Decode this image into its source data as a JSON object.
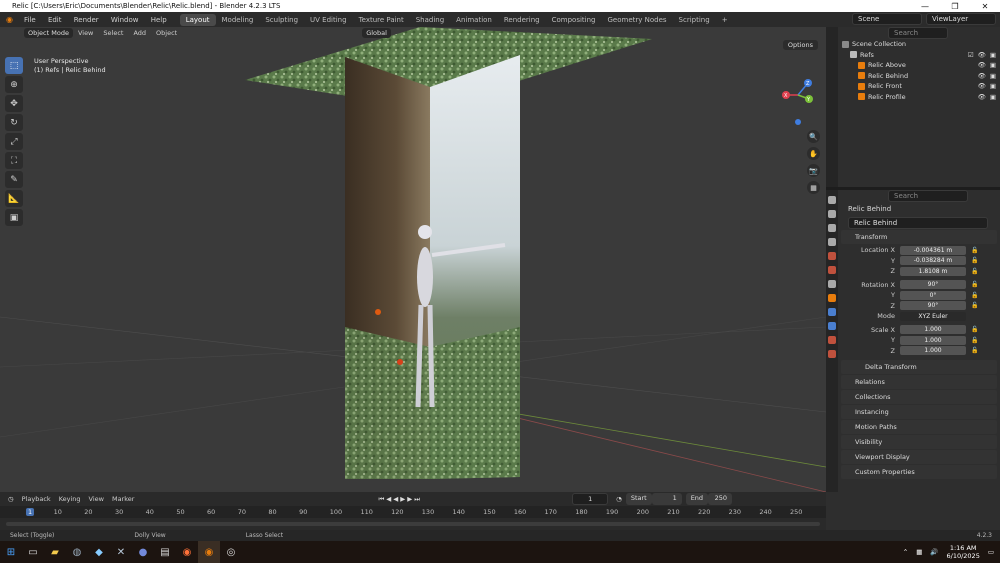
{
  "window": {
    "title": "Relic [C:\\Users\\Eric\\Documents\\Blender\\Relic\\Relic.blend] - Blender 4.2.3 LTS",
    "minimize": "—",
    "maximize": "❐",
    "close": "✕"
  },
  "menus": [
    "File",
    "Edit",
    "Render",
    "Window",
    "Help"
  ],
  "workspaces": [
    "Layout",
    "Modeling",
    "Sculpting",
    "UV Editing",
    "Texture Paint",
    "Shading",
    "Animation",
    "Rendering",
    "Compositing",
    "Geometry Nodes",
    "Scripting",
    "+"
  ],
  "active_workspace": "Layout",
  "scene": "Scene",
  "viewlayer": "ViewLayer",
  "viewport": {
    "mode": "Object Mode",
    "menus": [
      "View",
      "Select",
      "Add",
      "Object"
    ],
    "orientation": "Global",
    "options": "Options",
    "info_line1": "User Perspective",
    "info_line2": "(1) Refs | Relic Behind",
    "bg": "#3a3a3a"
  },
  "gizmo": {
    "x": "X",
    "y": "Y",
    "z": "Z"
  },
  "outliner": {
    "search_placeholder": "Search",
    "root": "Scene Collection",
    "collection": "Refs",
    "objects": [
      "Relic Above",
      "Relic Behind",
      "Relic Front",
      "Relic Profile"
    ]
  },
  "properties": {
    "search_placeholder": "Search",
    "object_name": "Relic Behind",
    "object_field": "Relic Behind",
    "transform_label": "Transform",
    "location": {
      "label": "Location X",
      "x": "-0.004361 m",
      "y": "-0.038284 m",
      "z": "1.8108 m"
    },
    "rotation": {
      "label": "Rotation X",
      "x": "90°",
      "y": "0°",
      "z": "90°"
    },
    "mode": {
      "label": "Mode",
      "value": "XYZ Euler"
    },
    "scale": {
      "label": "Scale X",
      "x": "1.000",
      "y": "1.000",
      "z": "1.000"
    },
    "y_label": "Y",
    "z_label": "Z",
    "delta": "Delta Transform",
    "panels": [
      "Relations",
      "Collections",
      "Instancing",
      "Motion Paths",
      "Visibility",
      "Viewport Display",
      "Custom Properties"
    ]
  },
  "timeline": {
    "menus": [
      "Playback",
      "Keying",
      "View",
      "Marker"
    ],
    "current_frame": "1",
    "start_label": "Start",
    "start": "1",
    "end_label": "End",
    "end": "250",
    "ticks": [
      "1",
      "10",
      "20",
      "30",
      "40",
      "50",
      "60",
      "70",
      "80",
      "90",
      "100",
      "110",
      "120",
      "130",
      "140",
      "150",
      "160",
      "170",
      "180",
      "190",
      "200",
      "210",
      "220",
      "230",
      "240",
      "250"
    ]
  },
  "status": {
    "select": "Select (Toggle)",
    "dolly": "Dolly View",
    "lasso": "Lasso Select",
    "version": "4.2.3"
  },
  "taskbar": {
    "time": "1:16 AM",
    "date": "6/10/2025"
  },
  "colors": {
    "accent": "#4772b3",
    "axis_x": "#e0404f",
    "axis_y": "#7cc13a",
    "axis_z": "#3f7de0"
  }
}
